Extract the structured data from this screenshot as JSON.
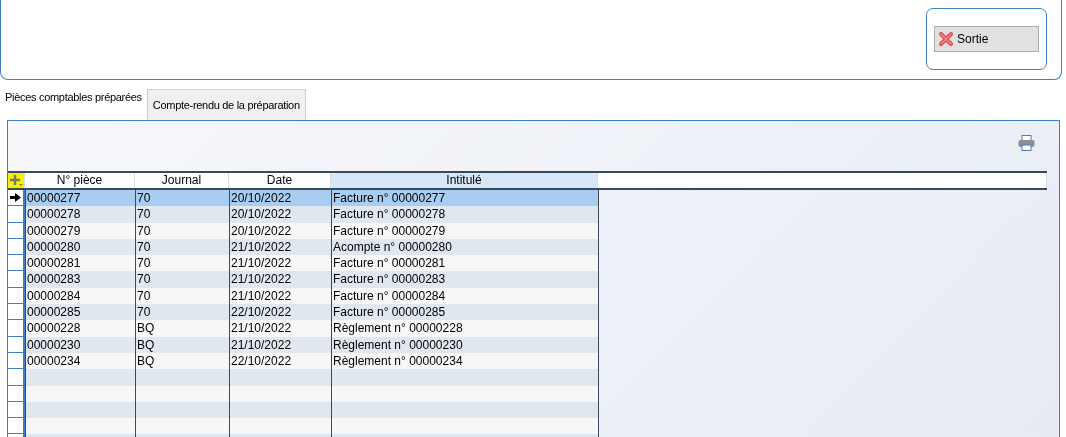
{
  "toolbar": {
    "exit_button": "Sortie"
  },
  "tabs": [
    {
      "label": "Pièces comptables préparées",
      "selected": true
    },
    {
      "label": "Compte-rendu de la préparation",
      "selected": false
    }
  ],
  "table": {
    "columns": [
      {
        "label": "N° pièce",
        "highlighted": false
      },
      {
        "label": "Journal",
        "highlighted": false
      },
      {
        "label": "Date",
        "highlighted": false
      },
      {
        "label": "Intitulé",
        "highlighted": true
      }
    ],
    "rows": [
      {
        "cells": [
          "00000277",
          "70",
          "20/10/2022",
          "Facture n° 00000277"
        ],
        "selected": true
      },
      {
        "cells": [
          "00000278",
          "70",
          "20/10/2022",
          "Facture n° 00000278"
        ],
        "selected": false
      },
      {
        "cells": [
          "00000279",
          "70",
          "20/10/2022",
          "Facture n° 00000279"
        ],
        "selected": false
      },
      {
        "cells": [
          "00000280",
          "70",
          "21/10/2022",
          "Acompte n° 00000280"
        ],
        "selected": false
      },
      {
        "cells": [
          "00000281",
          "70",
          "21/10/2022",
          "Facture n° 00000281"
        ],
        "selected": false
      },
      {
        "cells": [
          "00000283",
          "70",
          "21/10/2022",
          "Facture n° 00000283"
        ],
        "selected": false
      },
      {
        "cells": [
          "00000284",
          "70",
          "21/10/2022",
          "Facture n° 00000284"
        ],
        "selected": false
      },
      {
        "cells": [
          "00000285",
          "70",
          "22/10/2022",
          "Facture n° 00000285"
        ],
        "selected": false
      },
      {
        "cells": [
          "00000228",
          "BQ",
          "21/10/2022",
          "Règlement n° 00000228"
        ],
        "selected": false
      },
      {
        "cells": [
          "00000230",
          "BQ",
          "21/10/2022",
          "Règlement n° 00000230"
        ],
        "selected": false
      },
      {
        "cells": [
          "00000234",
          "BQ",
          "22/10/2022",
          "Règlement n° 00000234"
        ],
        "selected": false
      }
    ]
  }
}
